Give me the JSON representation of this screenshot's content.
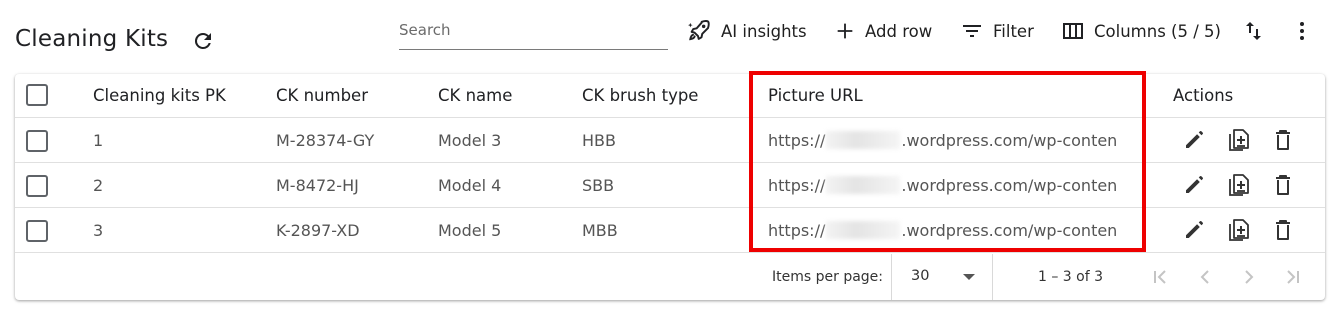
{
  "header": {
    "title": "Cleaning Kits",
    "search_placeholder": "Search",
    "ai_insights_label": "AI insights",
    "add_row_label": "Add row",
    "filter_label": "Filter",
    "columns_label": "Columns (5 / 5)"
  },
  "table": {
    "columns": [
      "Cleaning kits PK",
      "CK number",
      "CK name",
      "CK brush type",
      "Picture URL",
      "Actions"
    ],
    "rows": [
      {
        "pk": "1",
        "ck_number": "M-28374-GY",
        "ck_name": "Model 3",
        "brush_type": "HBB",
        "url_prefix": "https://",
        "url_suffix": ".wordpress.com/wp-conten"
      },
      {
        "pk": "2",
        "ck_number": "M-8472-HJ",
        "ck_name": "Model 4",
        "brush_type": "SBB",
        "url_prefix": "https://",
        "url_suffix": ".wordpress.com/wp-conten"
      },
      {
        "pk": "3",
        "ck_number": "K-2897-XD",
        "ck_name": "Model 5",
        "brush_type": "MBB",
        "url_prefix": "https://",
        "url_suffix": ".wordpress.com/wp-conten"
      }
    ]
  },
  "pagination": {
    "items_per_page_label": "Items per page:",
    "page_size": "30",
    "range_label": "1 – 3 of 3"
  },
  "icons": {
    "refresh": "refresh-icon",
    "ai": "rocket-sparkle-icon",
    "add": "plus-icon",
    "filter": "filter-lines-icon",
    "columns": "columns-icon",
    "sort": "sort-arrows-icon",
    "more": "more-vertical-icon",
    "edit": "pencil-icon",
    "duplicate": "copy-plus-icon",
    "delete": "trash-icon",
    "first": "first-page-icon",
    "prev": "chevron-left-icon",
    "next": "chevron-right-icon",
    "last": "last-page-icon"
  },
  "colors": {
    "highlight": "#ee0000",
    "text": "#202124",
    "muted_text": "#555555",
    "disabled": "#c4c4c4"
  }
}
